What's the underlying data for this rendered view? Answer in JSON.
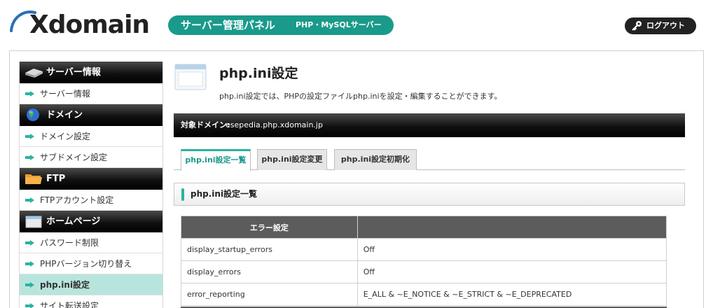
{
  "header": {
    "logo_text": "Xdomain",
    "panel_title": "サーバー管理パネル",
    "panel_subtitle": "PHP・MySQLサーバー",
    "logout_label": "ログアウト"
  },
  "sidebar": {
    "sections": [
      {
        "title": "サーバー情報",
        "icon": "server-icon",
        "items": [
          {
            "label": "サーバー情報"
          }
        ]
      },
      {
        "title": "ドメイン",
        "icon": "globe-icon",
        "items": [
          {
            "label": "ドメイン設定"
          },
          {
            "label": "サブドメイン設定"
          }
        ]
      },
      {
        "title": "FTP",
        "icon": "folder-icon",
        "items": [
          {
            "label": "FTPアカウント設定"
          }
        ]
      },
      {
        "title": "ホームページ",
        "icon": "window-icon",
        "items": [
          {
            "label": "パスワード制限"
          },
          {
            "label": "PHPバージョン切り替え"
          },
          {
            "label": "php.ini設定",
            "active": true
          },
          {
            "label": "サイト転送設定"
          }
        ]
      }
    ]
  },
  "main": {
    "title": "php.ini設定",
    "description": "php.ini設定では、PHPの設定ファイルphp.iniを設定・編集することができます。",
    "domain_label": "対象ドメイン:",
    "domain_value": "esepedia.php.xdomain.jp",
    "tabs": [
      {
        "label": "php.ini設定一覧",
        "active": true
      },
      {
        "label": "php.ini設定変更"
      },
      {
        "label": "php.ini設定初期化"
      }
    ],
    "section_title": "php.ini設定一覧",
    "table": {
      "header": [
        "エラー設定",
        ""
      ],
      "rows": [
        [
          "display_startup_errors",
          "Off"
        ],
        [
          "display_errors",
          "Off"
        ],
        [
          "error_reporting",
          "E_ALL & ~E_NOTICE & ~E_STRICT & ~E_DEPRECATED"
        ]
      ]
    }
  },
  "colors": {
    "accent": "#1a9a8a",
    "active_item_bg": "#b7e5dd",
    "header_dark": "#000000"
  }
}
